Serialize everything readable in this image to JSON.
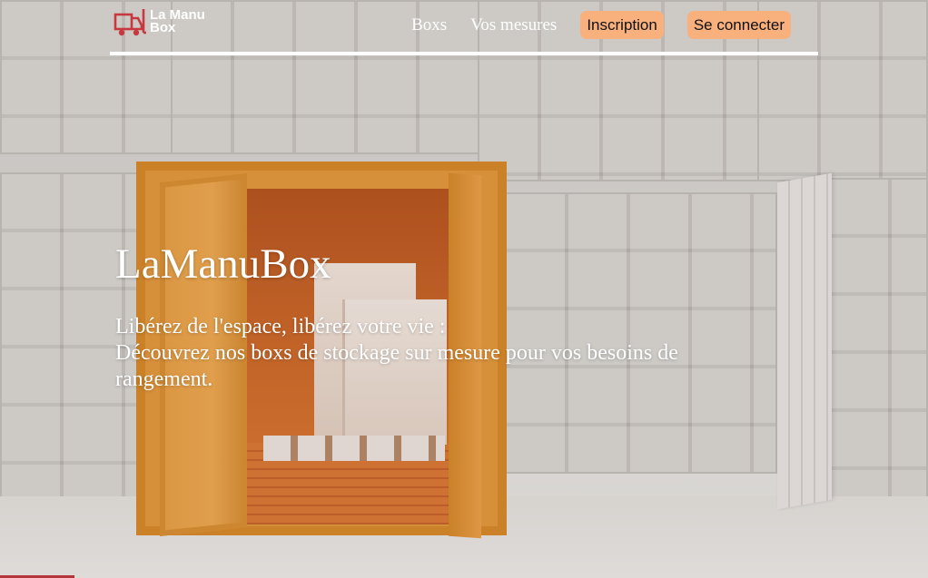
{
  "brand": {
    "logo_line1": "La Manu",
    "logo_line2": "Box",
    "logo_icon": "forklift-icon",
    "logo_color": "#c7383f"
  },
  "nav": {
    "links": [
      {
        "label": "Boxs"
      },
      {
        "label": "Vos mesures"
      }
    ],
    "buttons": [
      {
        "label": "Inscription"
      },
      {
        "label": "Se connecter"
      }
    ],
    "button_color": "#f8b07c"
  },
  "hero": {
    "title": "LaManuBox",
    "line1": "Libérez de l'espace, libérez votre vie :",
    "line2": "Découvrez nos boxs de stockage sur mesure pour vos besoins de rangement."
  },
  "colors": {
    "accent_orange": "#e69b3d",
    "header_rule": "#ffffff"
  }
}
